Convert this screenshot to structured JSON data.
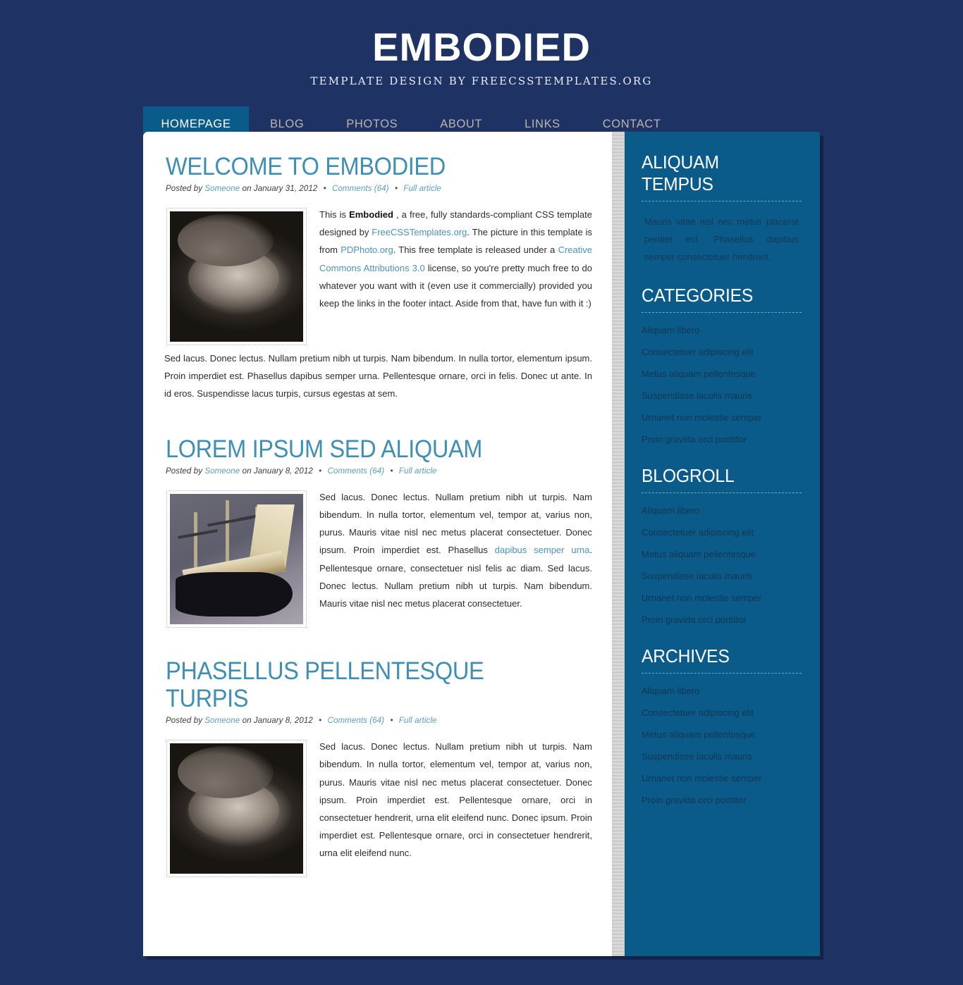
{
  "header": {
    "title": "EMBODIED",
    "tagline": "TEMPLATE DESIGN BY FREECSSTEMPLATES.ORG"
  },
  "colors": {
    "page_background": "#1e3264",
    "accent_blue": "#0b5b8a",
    "heading_blue": "#3f8fb4",
    "link_blue": "#4c93bb",
    "nav_inactive": "#b9b6ad"
  },
  "nav": {
    "items": [
      {
        "label": "HOMEPAGE",
        "active": true
      },
      {
        "label": "BLOG",
        "active": false
      },
      {
        "label": "PHOTOS",
        "active": false
      },
      {
        "label": "ABOUT",
        "active": false
      },
      {
        "label": "LINKS",
        "active": false
      },
      {
        "label": "CONTACT",
        "active": false
      }
    ]
  },
  "posts": [
    {
      "title": "WELCOME TO EMBODIED",
      "meta": {
        "posted_by_label": "Posted by",
        "author": "Someone",
        "on_label": "on",
        "date": "January 31, 2012",
        "comments": "Comments (64)",
        "full_article": "Full article"
      },
      "image_name": "coin-photo",
      "paragraphs": [
        "This is Embodied , a free, fully standards-compliant CSS template designed by FreeCSSTemplates.org. The picture in this template is from PDPhoto.org. This free template is released under a Creative Commons Attributions 3.0 license, so you're pretty much free to do whatever you want with it (even use it commercially) provided you keep the links in the footer intact. Aside from that, have fun with it :)",
        "Sed lacus. Donec lectus. Nullam pretium nibh ut turpis. Nam bibendum. In nulla tortor, elementum ipsum. Proin imperdiet est. Phasellus dapibus semper urna. Pellentesque ornare, orci in felis. Donec ut ante. In id eros. Suspendisse lacus turpis, cursus egestas at sem."
      ],
      "inline": {
        "bold_term": "Embodied",
        "link_1": "FreeCSSTemplates.org",
        "link_2": "PDPhoto.org",
        "link_3": "Creative Commons Attributions 3.0",
        "t1": "This is ",
        "t2": " , a free, fully standards-compliant CSS template designed by ",
        "t3": ". The picture in this template is from ",
        "t4": ". This free template is released under a ",
        "t5": " license, so you're pretty much free to do whatever you want with it (even use it commercially) provided you keep the links in the footer intact. Aside from that, have fun with it :)"
      }
    },
    {
      "title": "LOREM IPSUM SED ALIQUAM",
      "meta": {
        "posted_by_label": "Posted by",
        "author": "Someone",
        "on_label": "on",
        "date": "January 8, 2012",
        "comments": "Comments (64)",
        "full_article": "Full article"
      },
      "image_name": "sailing-ship-photo",
      "inline": {
        "t1": "Sed lacus. Donec lectus. Nullam pretium nibh ut turpis. Nam bibendum. In nulla tortor, elementum vel, tempor at, varius non, purus. Mauris vitae nisl nec metus placerat consectetuer. Donec ipsum. Proin imperdiet est. Phasellus ",
        "link_1": "dapibus semper urna",
        "t2": ". Pellentesque ornare, consectetuer nisl felis ac diam. Sed lacus. Donec lectus. Nullam pretium nibh ut turpis. Nam bibendum. Mauris vitae nisl nec metus placerat consectetuer."
      }
    },
    {
      "title": "PHASELLUS PELLENTESQUE TURPIS",
      "meta": {
        "posted_by_label": "Posted by",
        "author": "Someone",
        "on_label": "on",
        "date": "January 8, 2012",
        "comments": "Comments (64)",
        "full_article": "Full article"
      },
      "image_name": "coin-photo",
      "body": "Sed lacus. Donec lectus. Nullam pretium nibh ut turpis. Nam bibendum. In nulla tortor, elementum vel, tempor at, varius non, purus. Mauris vitae nisl nec metus placerat consectetuer. Donec ipsum. Proin imperdiet est. Pellentesque ornare, orci in consectetuer hendrerit, urna elit eleifend nunc. Donec ipsum. Proin imperdiet est. Pellentesque ornare, orci in consectetuer hendrerit, urna elit eleifend nunc."
    }
  ],
  "sidebar": {
    "boxes": [
      {
        "title": "ALIQUAM TEMPUS",
        "type": "text",
        "text": "Mauris vitae nisl nec metus placerat perdiet est. Phasellus dapibus semper consectetuer hendrerit."
      },
      {
        "title": "CATEGORIES",
        "type": "list",
        "items": [
          "Aliquam libero",
          "Consectetuer adipiscing elit",
          "Metus aliquam pellentesque",
          "Suspendisse iaculis mauris",
          "Urnanet non molestie semper",
          "Proin gravida orci porttitor"
        ]
      },
      {
        "title": "BLOGROLL",
        "type": "list",
        "items": [
          "Aliquam libero",
          "Consectetuer adipiscing elit",
          "Metus aliquam pellentesque",
          "Suspendisse iaculis mauris",
          "Urnanet non molestie semper",
          "Proin gravida orci porttitor"
        ]
      },
      {
        "title": "ARCHIVES",
        "type": "list",
        "items": [
          "Aliquam libero",
          "Consectetuer adipiscing elit",
          "Metus aliquam pellentesque",
          "Suspendisse iaculis mauris",
          "Urnanet non molestie semper",
          "Proin gravida orci porttitor"
        ]
      }
    ]
  }
}
